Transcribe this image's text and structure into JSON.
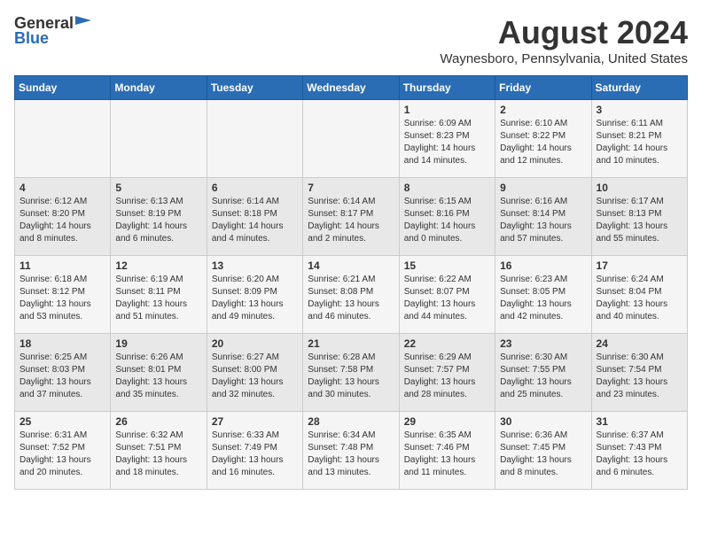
{
  "header": {
    "logo_general": "General",
    "logo_blue": "Blue",
    "month_year": "August 2024",
    "location": "Waynesboro, Pennsylvania, United States"
  },
  "calendar": {
    "days_of_week": [
      "Sunday",
      "Monday",
      "Tuesday",
      "Wednesday",
      "Thursday",
      "Friday",
      "Saturday"
    ],
    "weeks": [
      [
        {
          "day": "",
          "info": ""
        },
        {
          "day": "",
          "info": ""
        },
        {
          "day": "",
          "info": ""
        },
        {
          "day": "",
          "info": ""
        },
        {
          "day": "1",
          "info": "Sunrise: 6:09 AM\nSunset: 8:23 PM\nDaylight: 14 hours\nand 14 minutes."
        },
        {
          "day": "2",
          "info": "Sunrise: 6:10 AM\nSunset: 8:22 PM\nDaylight: 14 hours\nand 12 minutes."
        },
        {
          "day": "3",
          "info": "Sunrise: 6:11 AM\nSunset: 8:21 PM\nDaylight: 14 hours\nand 10 minutes."
        }
      ],
      [
        {
          "day": "4",
          "info": "Sunrise: 6:12 AM\nSunset: 8:20 PM\nDaylight: 14 hours\nand 8 minutes."
        },
        {
          "day": "5",
          "info": "Sunrise: 6:13 AM\nSunset: 8:19 PM\nDaylight: 14 hours\nand 6 minutes."
        },
        {
          "day": "6",
          "info": "Sunrise: 6:14 AM\nSunset: 8:18 PM\nDaylight: 14 hours\nand 4 minutes."
        },
        {
          "day": "7",
          "info": "Sunrise: 6:14 AM\nSunset: 8:17 PM\nDaylight: 14 hours\nand 2 minutes."
        },
        {
          "day": "8",
          "info": "Sunrise: 6:15 AM\nSunset: 8:16 PM\nDaylight: 14 hours\nand 0 minutes."
        },
        {
          "day": "9",
          "info": "Sunrise: 6:16 AM\nSunset: 8:14 PM\nDaylight: 13 hours\nand 57 minutes."
        },
        {
          "day": "10",
          "info": "Sunrise: 6:17 AM\nSunset: 8:13 PM\nDaylight: 13 hours\nand 55 minutes."
        }
      ],
      [
        {
          "day": "11",
          "info": "Sunrise: 6:18 AM\nSunset: 8:12 PM\nDaylight: 13 hours\nand 53 minutes."
        },
        {
          "day": "12",
          "info": "Sunrise: 6:19 AM\nSunset: 8:11 PM\nDaylight: 13 hours\nand 51 minutes."
        },
        {
          "day": "13",
          "info": "Sunrise: 6:20 AM\nSunset: 8:09 PM\nDaylight: 13 hours\nand 49 minutes."
        },
        {
          "day": "14",
          "info": "Sunrise: 6:21 AM\nSunset: 8:08 PM\nDaylight: 13 hours\nand 46 minutes."
        },
        {
          "day": "15",
          "info": "Sunrise: 6:22 AM\nSunset: 8:07 PM\nDaylight: 13 hours\nand 44 minutes."
        },
        {
          "day": "16",
          "info": "Sunrise: 6:23 AM\nSunset: 8:05 PM\nDaylight: 13 hours\nand 42 minutes."
        },
        {
          "day": "17",
          "info": "Sunrise: 6:24 AM\nSunset: 8:04 PM\nDaylight: 13 hours\nand 40 minutes."
        }
      ],
      [
        {
          "day": "18",
          "info": "Sunrise: 6:25 AM\nSunset: 8:03 PM\nDaylight: 13 hours\nand 37 minutes."
        },
        {
          "day": "19",
          "info": "Sunrise: 6:26 AM\nSunset: 8:01 PM\nDaylight: 13 hours\nand 35 minutes."
        },
        {
          "day": "20",
          "info": "Sunrise: 6:27 AM\nSunset: 8:00 PM\nDaylight: 13 hours\nand 32 minutes."
        },
        {
          "day": "21",
          "info": "Sunrise: 6:28 AM\nSunset: 7:58 PM\nDaylight: 13 hours\nand 30 minutes."
        },
        {
          "day": "22",
          "info": "Sunrise: 6:29 AM\nSunset: 7:57 PM\nDaylight: 13 hours\nand 28 minutes."
        },
        {
          "day": "23",
          "info": "Sunrise: 6:30 AM\nSunset: 7:55 PM\nDaylight: 13 hours\nand 25 minutes."
        },
        {
          "day": "24",
          "info": "Sunrise: 6:30 AM\nSunset: 7:54 PM\nDaylight: 13 hours\nand 23 minutes."
        }
      ],
      [
        {
          "day": "25",
          "info": "Sunrise: 6:31 AM\nSunset: 7:52 PM\nDaylight: 13 hours\nand 20 minutes."
        },
        {
          "day": "26",
          "info": "Sunrise: 6:32 AM\nSunset: 7:51 PM\nDaylight: 13 hours\nand 18 minutes."
        },
        {
          "day": "27",
          "info": "Sunrise: 6:33 AM\nSunset: 7:49 PM\nDaylight: 13 hours\nand 16 minutes."
        },
        {
          "day": "28",
          "info": "Sunrise: 6:34 AM\nSunset: 7:48 PM\nDaylight: 13 hours\nand 13 minutes."
        },
        {
          "day": "29",
          "info": "Sunrise: 6:35 AM\nSunset: 7:46 PM\nDaylight: 13 hours\nand 11 minutes."
        },
        {
          "day": "30",
          "info": "Sunrise: 6:36 AM\nSunset: 7:45 PM\nDaylight: 13 hours\nand 8 minutes."
        },
        {
          "day": "31",
          "info": "Sunrise: 6:37 AM\nSunset: 7:43 PM\nDaylight: 13 hours\nand 6 minutes."
        }
      ]
    ]
  }
}
